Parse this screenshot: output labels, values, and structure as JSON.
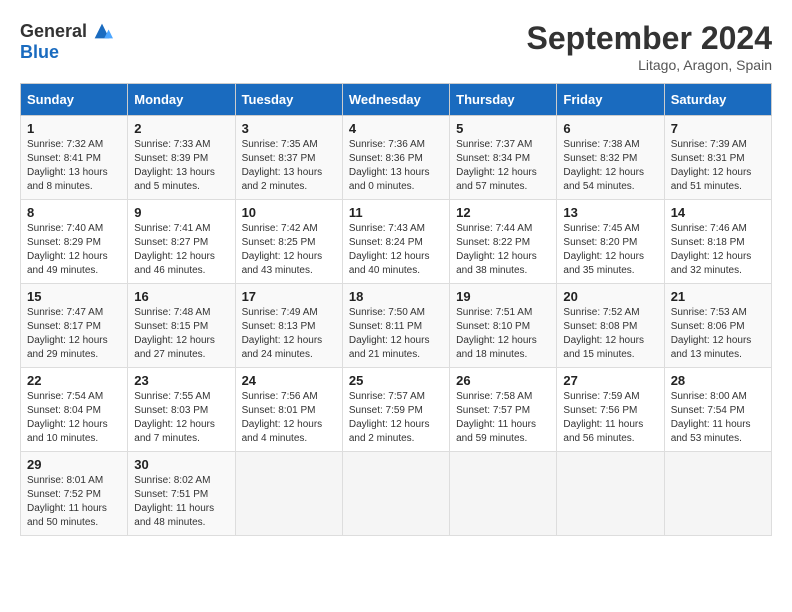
{
  "header": {
    "logo_general": "General",
    "logo_blue": "Blue",
    "month": "September 2024",
    "location": "Litago, Aragon, Spain"
  },
  "days_of_week": [
    "Sunday",
    "Monday",
    "Tuesday",
    "Wednesday",
    "Thursday",
    "Friday",
    "Saturday"
  ],
  "weeks": [
    [
      {
        "day": "1",
        "sunrise": "Sunrise: 7:32 AM",
        "sunset": "Sunset: 8:41 PM",
        "daylight": "Daylight: 13 hours and 8 minutes."
      },
      {
        "day": "2",
        "sunrise": "Sunrise: 7:33 AM",
        "sunset": "Sunset: 8:39 PM",
        "daylight": "Daylight: 13 hours and 5 minutes."
      },
      {
        "day": "3",
        "sunrise": "Sunrise: 7:35 AM",
        "sunset": "Sunset: 8:37 PM",
        "daylight": "Daylight: 13 hours and 2 minutes."
      },
      {
        "day": "4",
        "sunrise": "Sunrise: 7:36 AM",
        "sunset": "Sunset: 8:36 PM",
        "daylight": "Daylight: 13 hours and 0 minutes."
      },
      {
        "day": "5",
        "sunrise": "Sunrise: 7:37 AM",
        "sunset": "Sunset: 8:34 PM",
        "daylight": "Daylight: 12 hours and 57 minutes."
      },
      {
        "day": "6",
        "sunrise": "Sunrise: 7:38 AM",
        "sunset": "Sunset: 8:32 PM",
        "daylight": "Daylight: 12 hours and 54 minutes."
      },
      {
        "day": "7",
        "sunrise": "Sunrise: 7:39 AM",
        "sunset": "Sunset: 8:31 PM",
        "daylight": "Daylight: 12 hours and 51 minutes."
      }
    ],
    [
      {
        "day": "8",
        "sunrise": "Sunrise: 7:40 AM",
        "sunset": "Sunset: 8:29 PM",
        "daylight": "Daylight: 12 hours and 49 minutes."
      },
      {
        "day": "9",
        "sunrise": "Sunrise: 7:41 AM",
        "sunset": "Sunset: 8:27 PM",
        "daylight": "Daylight: 12 hours and 46 minutes."
      },
      {
        "day": "10",
        "sunrise": "Sunrise: 7:42 AM",
        "sunset": "Sunset: 8:25 PM",
        "daylight": "Daylight: 12 hours and 43 minutes."
      },
      {
        "day": "11",
        "sunrise": "Sunrise: 7:43 AM",
        "sunset": "Sunset: 8:24 PM",
        "daylight": "Daylight: 12 hours and 40 minutes."
      },
      {
        "day": "12",
        "sunrise": "Sunrise: 7:44 AM",
        "sunset": "Sunset: 8:22 PM",
        "daylight": "Daylight: 12 hours and 38 minutes."
      },
      {
        "day": "13",
        "sunrise": "Sunrise: 7:45 AM",
        "sunset": "Sunset: 8:20 PM",
        "daylight": "Daylight: 12 hours and 35 minutes."
      },
      {
        "day": "14",
        "sunrise": "Sunrise: 7:46 AM",
        "sunset": "Sunset: 8:18 PM",
        "daylight": "Daylight: 12 hours and 32 minutes."
      }
    ],
    [
      {
        "day": "15",
        "sunrise": "Sunrise: 7:47 AM",
        "sunset": "Sunset: 8:17 PM",
        "daylight": "Daylight: 12 hours and 29 minutes."
      },
      {
        "day": "16",
        "sunrise": "Sunrise: 7:48 AM",
        "sunset": "Sunset: 8:15 PM",
        "daylight": "Daylight: 12 hours and 27 minutes."
      },
      {
        "day": "17",
        "sunrise": "Sunrise: 7:49 AM",
        "sunset": "Sunset: 8:13 PM",
        "daylight": "Daylight: 12 hours and 24 minutes."
      },
      {
        "day": "18",
        "sunrise": "Sunrise: 7:50 AM",
        "sunset": "Sunset: 8:11 PM",
        "daylight": "Daylight: 12 hours and 21 minutes."
      },
      {
        "day": "19",
        "sunrise": "Sunrise: 7:51 AM",
        "sunset": "Sunset: 8:10 PM",
        "daylight": "Daylight: 12 hours and 18 minutes."
      },
      {
        "day": "20",
        "sunrise": "Sunrise: 7:52 AM",
        "sunset": "Sunset: 8:08 PM",
        "daylight": "Daylight: 12 hours and 15 minutes."
      },
      {
        "day": "21",
        "sunrise": "Sunrise: 7:53 AM",
        "sunset": "Sunset: 8:06 PM",
        "daylight": "Daylight: 12 hours and 13 minutes."
      }
    ],
    [
      {
        "day": "22",
        "sunrise": "Sunrise: 7:54 AM",
        "sunset": "Sunset: 8:04 PM",
        "daylight": "Daylight: 12 hours and 10 minutes."
      },
      {
        "day": "23",
        "sunrise": "Sunrise: 7:55 AM",
        "sunset": "Sunset: 8:03 PM",
        "daylight": "Daylight: 12 hours and 7 minutes."
      },
      {
        "day": "24",
        "sunrise": "Sunrise: 7:56 AM",
        "sunset": "Sunset: 8:01 PM",
        "daylight": "Daylight: 12 hours and 4 minutes."
      },
      {
        "day": "25",
        "sunrise": "Sunrise: 7:57 AM",
        "sunset": "Sunset: 7:59 PM",
        "daylight": "Daylight: 12 hours and 2 minutes."
      },
      {
        "day": "26",
        "sunrise": "Sunrise: 7:58 AM",
        "sunset": "Sunset: 7:57 PM",
        "daylight": "Daylight: 11 hours and 59 minutes."
      },
      {
        "day": "27",
        "sunrise": "Sunrise: 7:59 AM",
        "sunset": "Sunset: 7:56 PM",
        "daylight": "Daylight: 11 hours and 56 minutes."
      },
      {
        "day": "28",
        "sunrise": "Sunrise: 8:00 AM",
        "sunset": "Sunset: 7:54 PM",
        "daylight": "Daylight: 11 hours and 53 minutes."
      }
    ],
    [
      {
        "day": "29",
        "sunrise": "Sunrise: 8:01 AM",
        "sunset": "Sunset: 7:52 PM",
        "daylight": "Daylight: 11 hours and 50 minutes."
      },
      {
        "day": "30",
        "sunrise": "Sunrise: 8:02 AM",
        "sunset": "Sunset: 7:51 PM",
        "daylight": "Daylight: 11 hours and 48 minutes."
      },
      null,
      null,
      null,
      null,
      null
    ]
  ]
}
